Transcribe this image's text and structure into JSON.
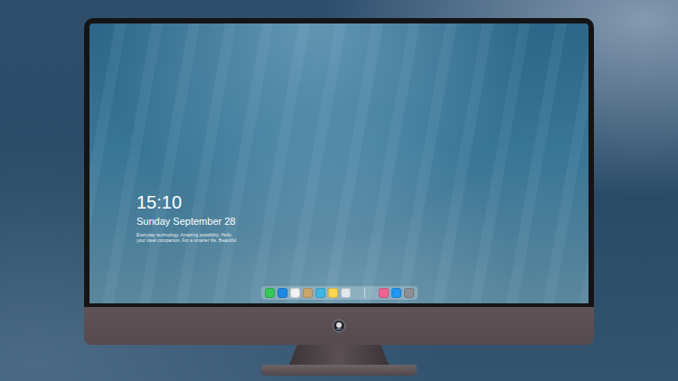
{
  "lock_screen": {
    "time": "15:10",
    "date": "Sunday September 28",
    "tagline": [
      "Everyday technology. Amazing possibility. Hello",
      "your ideal companion. For a smarter life. Beautiful"
    ]
  },
  "dock": [
    {
      "items": [
        {
          "color": "#34c759"
        },
        {
          "color": "#1e88e5"
        },
        {
          "color": "#f2f2f2"
        },
        {
          "color": "#c9a66b"
        },
        {
          "color": "#3fb6e0"
        },
        {
          "color": "#ffd54f"
        },
        {
          "color": "#e0e6ea"
        }
      ]
    },
    {
      "items": [
        {
          "color": "#f06292"
        },
        {
          "color": "#2196f3"
        },
        {
          "color": "#8e8e93"
        }
      ]
    }
  ]
}
